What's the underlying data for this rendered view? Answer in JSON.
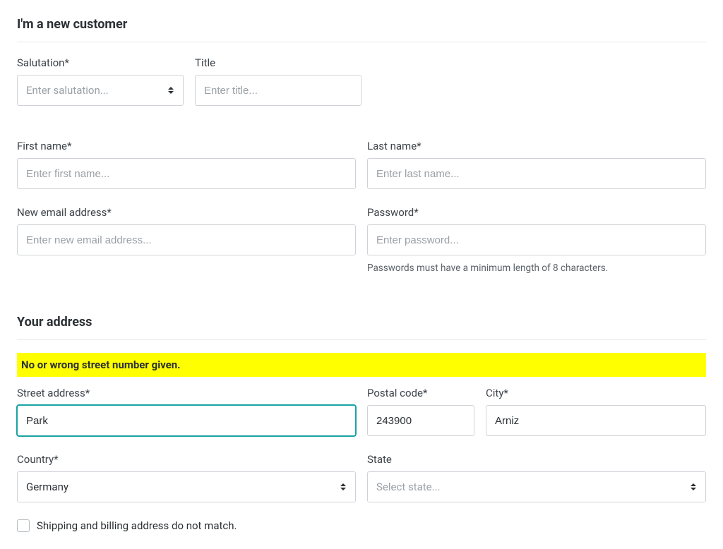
{
  "section1": {
    "title": "I'm a new customer"
  },
  "salutation": {
    "label": "Salutation*",
    "placeholder": "Enter salutation..."
  },
  "title": {
    "label": "Title",
    "placeholder": "Enter title..."
  },
  "firstName": {
    "label": "First name*",
    "placeholder": "Enter first name..."
  },
  "lastName": {
    "label": "Last name*",
    "placeholder": "Enter last name..."
  },
  "email": {
    "label": "New email address*",
    "placeholder": "Enter new email address..."
  },
  "password": {
    "label": "Password*",
    "placeholder": "Enter password...",
    "hint": "Passwords must have a minimum length of 8 characters."
  },
  "section2": {
    "title": "Your address"
  },
  "alert": "No or wrong street number given.",
  "street": {
    "label": "Street address*",
    "value": "Park"
  },
  "postal": {
    "label": "Postal code*",
    "value": "243900"
  },
  "city": {
    "label": "City*",
    "value": "Arniz"
  },
  "country": {
    "label": "Country*",
    "value": "Germany"
  },
  "state": {
    "label": "State",
    "placeholder": "Select state..."
  },
  "shipping": {
    "label": "Shipping and billing address do not match."
  }
}
